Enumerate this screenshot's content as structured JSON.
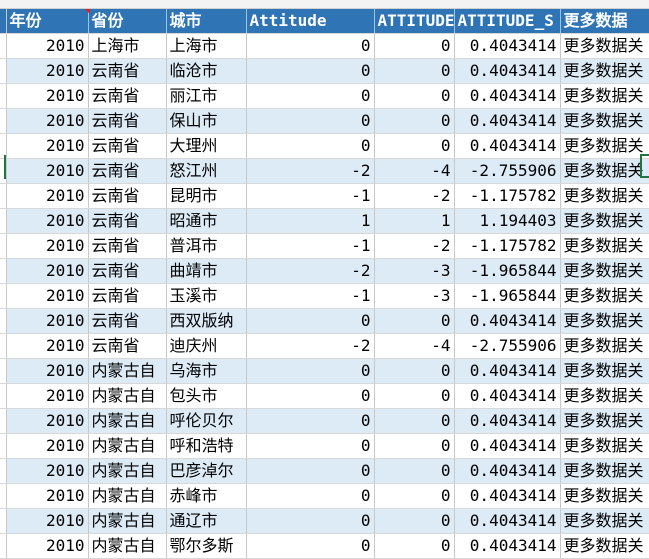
{
  "columns": [
    "年份",
    "省份",
    "城市",
    "Attitude",
    "ATTITUDE",
    "ATTITUDE_S",
    "更多数据"
  ],
  "rows": [
    [
      "2010",
      "上海市",
      "上海市",
      "0",
      "0",
      "0.4043414",
      "更多数据关"
    ],
    [
      "2010",
      "云南省",
      "临沧市",
      "0",
      "0",
      "0.4043414",
      "更多数据关"
    ],
    [
      "2010",
      "云南省",
      "丽江市",
      "0",
      "0",
      "0.4043414",
      "更多数据关"
    ],
    [
      "2010",
      "云南省",
      "保山市",
      "0",
      "0",
      "0.4043414",
      "更多数据关"
    ],
    [
      "2010",
      "云南省",
      "大理州",
      "0",
      "0",
      "0.4043414",
      "更多数据关"
    ],
    [
      "2010",
      "云南省",
      "怒江州",
      "-2",
      "-4",
      "-2.755906",
      "更多数据关"
    ],
    [
      "2010",
      "云南省",
      "昆明市",
      "-1",
      "-2",
      "-1.175782",
      "更多数据关"
    ],
    [
      "2010",
      "云南省",
      "昭通市",
      "1",
      "1",
      "1.194403",
      "更多数据关"
    ],
    [
      "2010",
      "云南省",
      "普洱市",
      "-1",
      "-2",
      "-1.175782",
      "更多数据关"
    ],
    [
      "2010",
      "云南省",
      "曲靖市",
      "-2",
      "-3",
      "-1.965844",
      "更多数据关"
    ],
    [
      "2010",
      "云南省",
      "玉溪市",
      "-1",
      "-3",
      "-1.965844",
      "更多数据关"
    ],
    [
      "2010",
      "云南省",
      "西双版纳",
      "0",
      "0",
      "0.4043414",
      "更多数据关"
    ],
    [
      "2010",
      "云南省",
      "迪庆州",
      "-2",
      "-4",
      "-2.755906",
      "更多数据关"
    ],
    [
      "2010",
      "内蒙古自",
      "乌海市",
      "0",
      "0",
      "0.4043414",
      "更多数据关"
    ],
    [
      "2010",
      "内蒙古自",
      "包头市",
      "0",
      "0",
      "0.4043414",
      "更多数据关"
    ],
    [
      "2010",
      "内蒙古自",
      "呼伦贝尔",
      "0",
      "0",
      "0.4043414",
      "更多数据关"
    ],
    [
      "2010",
      "内蒙古自",
      "呼和浩特",
      "0",
      "0",
      "0.4043414",
      "更多数据关"
    ],
    [
      "2010",
      "内蒙古自",
      "巴彦淖尔",
      "0",
      "0",
      "0.4043414",
      "更多数据关"
    ],
    [
      "2010",
      "内蒙古自",
      "赤峰市",
      "0",
      "0",
      "0.4043414",
      "更多数据关"
    ],
    [
      "2010",
      "内蒙古自",
      "通辽市",
      "0",
      "0",
      "0.4043414",
      "更多数据关"
    ],
    [
      "2010",
      "内蒙古自",
      "鄂尔多斯",
      "0",
      "0",
      "0.4043414",
      "更多数据关"
    ]
  ],
  "colors": {
    "header_bg": "#2f75b5",
    "band_bg": "#ddebf7",
    "selection": "#217346",
    "comment_marker": "#e02020"
  }
}
